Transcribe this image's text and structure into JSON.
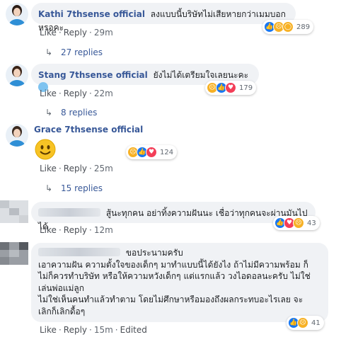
{
  "actions": {
    "like": "Like",
    "reply": "Reply",
    "edited": "Edited"
  },
  "comments": [
    {
      "author": "Kathi 7thsense official",
      "text": "ลงแบบนี้บริษัทไม่เสียหายกว่าเมมบอกหรอคะ",
      "time": "29m",
      "reactions": [
        "like",
        "sad",
        "wow"
      ],
      "count": "289",
      "replies": "27 replies"
    },
    {
      "author": "Stang 7thsense official",
      "text": "ยังไม่ได้เตรียมใจเลยนะคะ",
      "time": "22m",
      "reactions": [
        "sad",
        "like",
        "love"
      ],
      "count": "179",
      "replies": "8 replies"
    },
    {
      "author": "Grace 7thsense official",
      "text": "",
      "time": "25m",
      "reactions": [
        "sad",
        "like",
        "love"
      ],
      "count": "124",
      "replies": "15 replies"
    },
    {
      "author": "",
      "text": "สู้นะทุกคน อย่าทิ้งความฝันนะ เชื่อว่าทุกคนจะผ่านมันไปได้",
      "time": "12m",
      "reactions": [
        "like",
        "love",
        "sad"
      ],
      "count": "43"
    },
    {
      "author": "",
      "line1": "ขอประนามครับ",
      "line2": "เอาความฝัน ความตั้งใจของเด็กๆ มาทำแบบนี้ได้ยังไง ถ้าไม่มีความพร้อม ก็",
      "line3": "ไม่ก็ควรทำบริษัท หรือให้ความหวังเด็กๆ แต่แรกแล้ว วงไอดอลนะครับ ไม่ใช่",
      "line4": "เล่นพ่อแม่ลูก",
      "line5": "ไม่ใช่เห็นคนทำแล้วทำตาม โดยไม่ศึกษาหรือมองถึงผลกระทบอะไรเลย จะ",
      "line6": "เลิกก็เลิกดื้อๆ",
      "time": "15m",
      "reactions": [
        "like",
        "sad"
      ],
      "count": "41"
    }
  ]
}
